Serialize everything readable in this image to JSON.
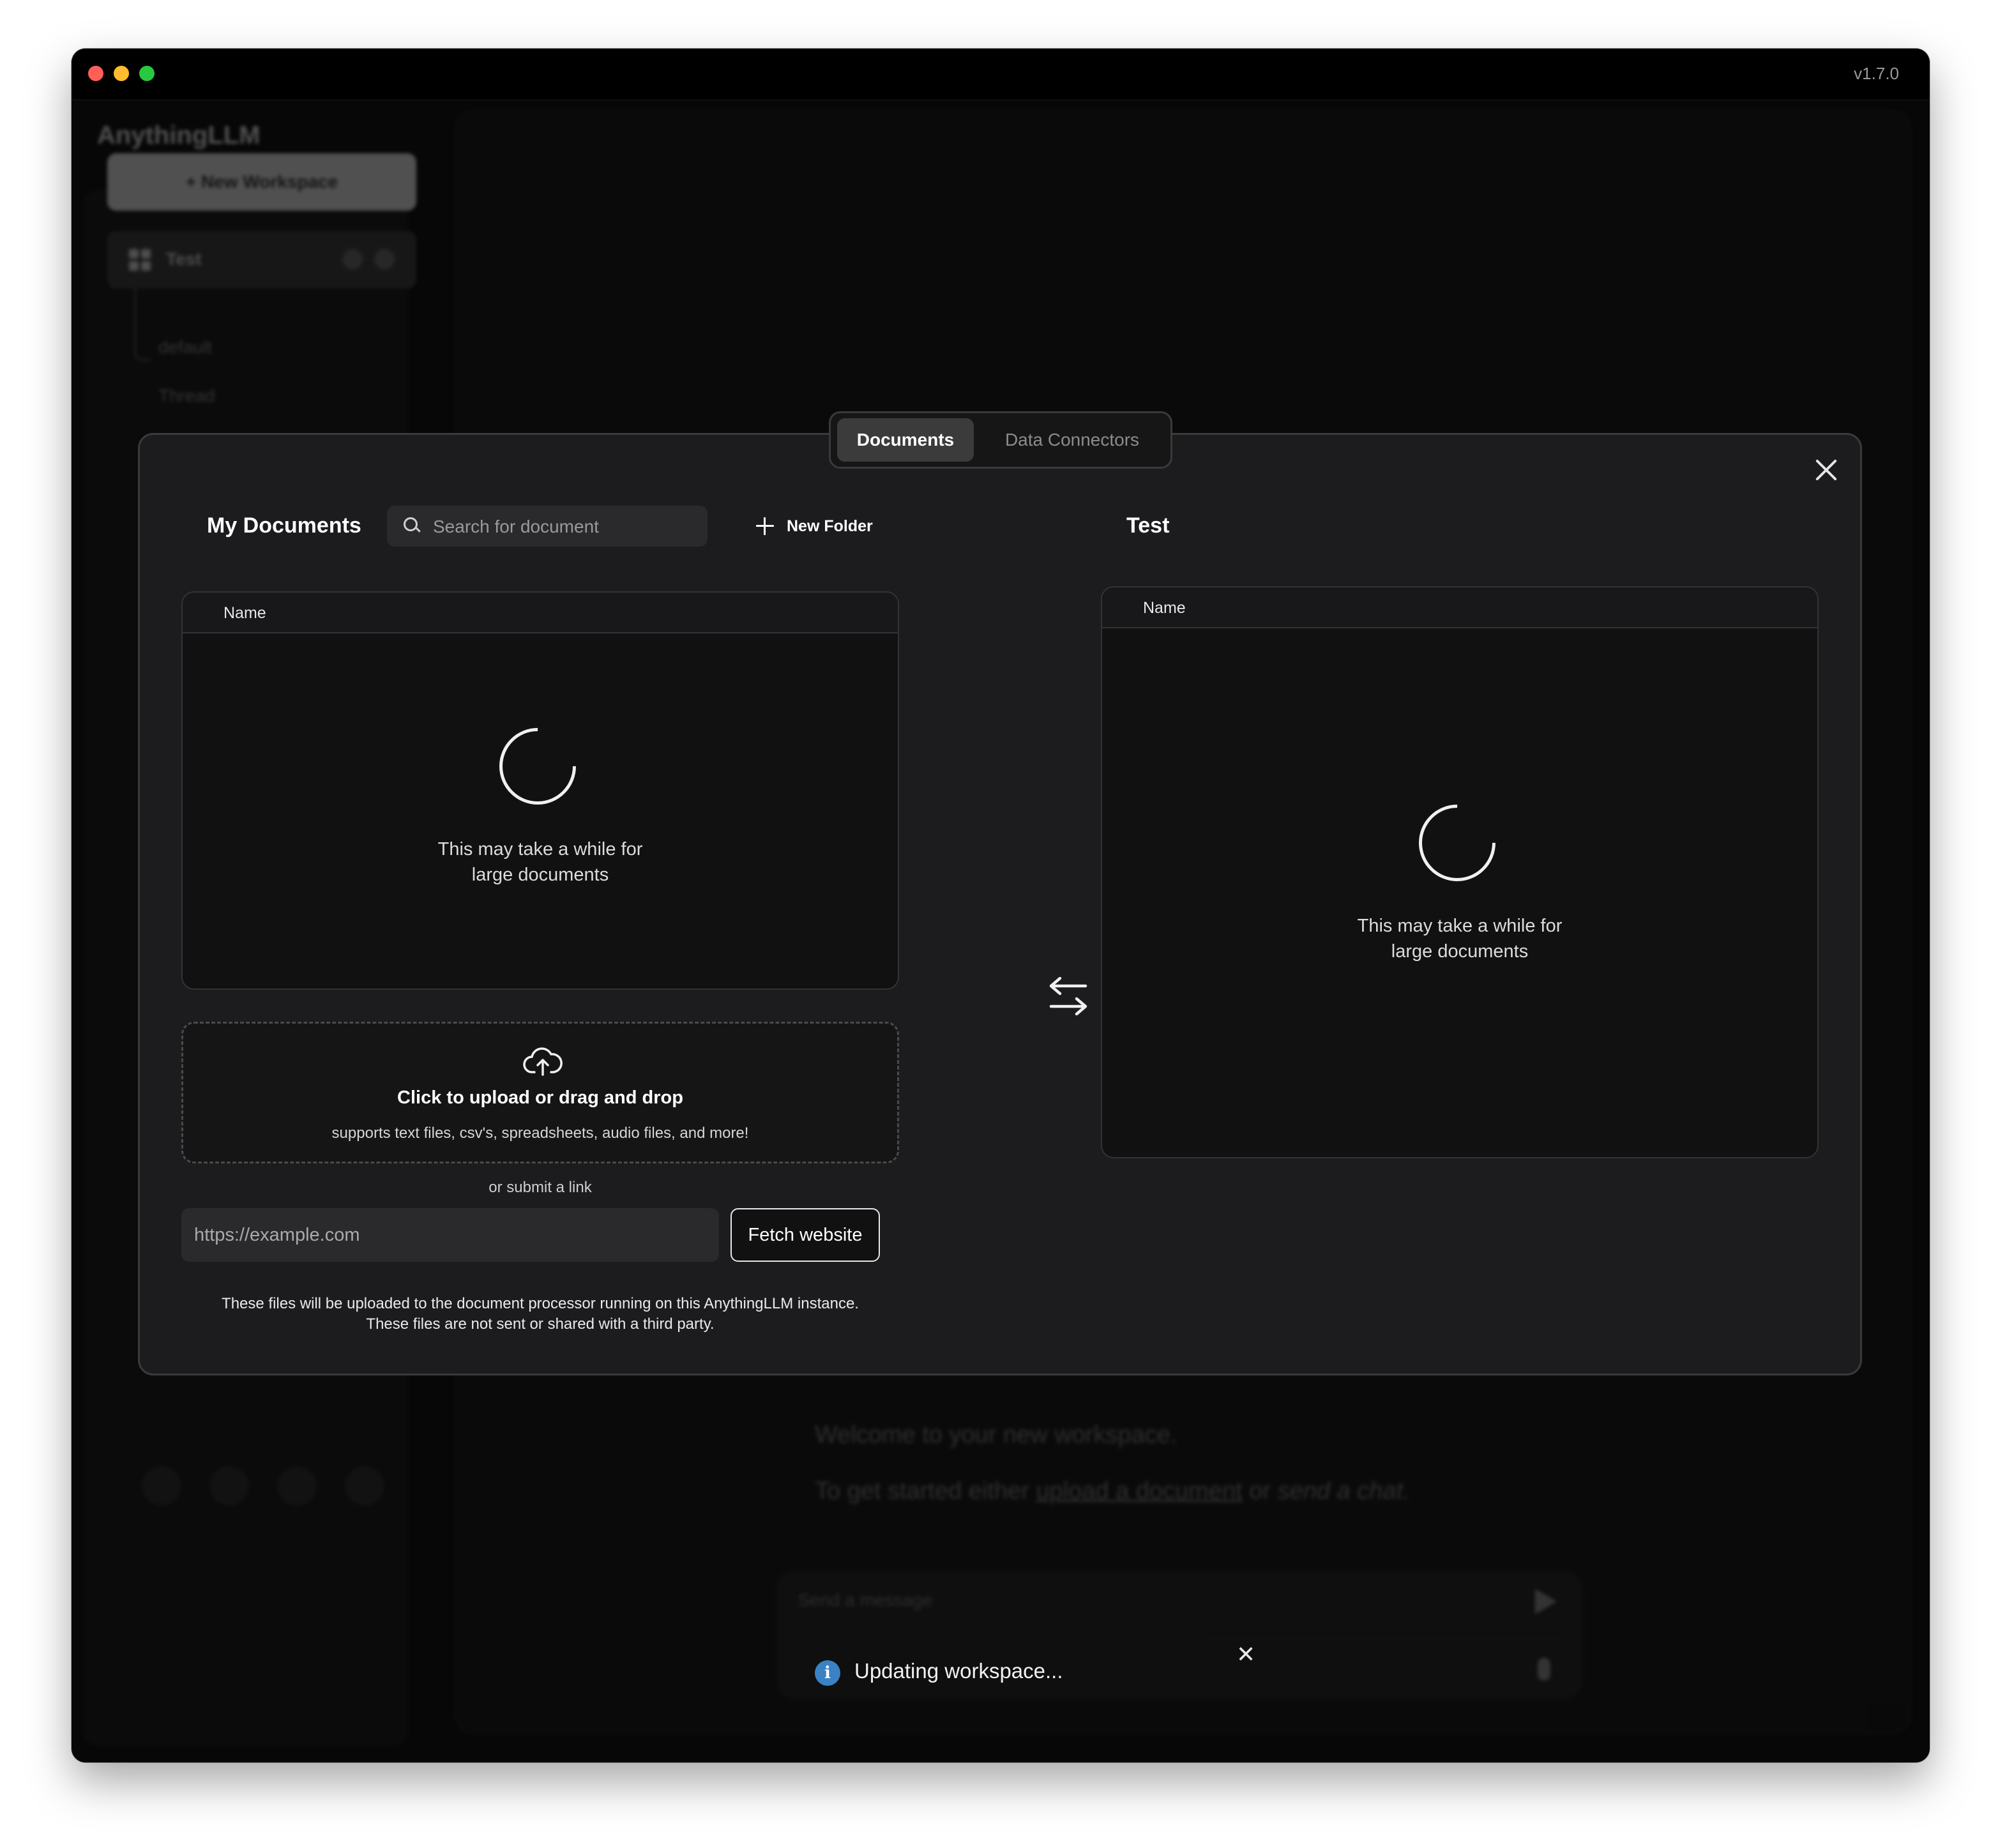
{
  "window": {
    "version": "v1.7.0"
  },
  "background": {
    "brand": "AnythingLLM",
    "new_workspace_label": "+  New Workspace",
    "workspace_name": "Test",
    "threads": [
      "default",
      "Thread"
    ],
    "welcome_line1": "Welcome to your new workspace.",
    "welcome_line2_pre": "To get started either ",
    "welcome_link_upload": "upload a document",
    "welcome_line2_mid": " or ",
    "welcome_link_chat": "send a chat.",
    "chat_placeholder": "Send a message"
  },
  "modal": {
    "tabs": [
      {
        "label": "Documents",
        "active": true
      },
      {
        "label": "Data Connectors",
        "active": false
      }
    ],
    "my_documents_title": "My Documents",
    "search_placeholder": "Search for document",
    "new_folder_label": "New Folder",
    "workspace_title": "Test",
    "left_table": {
      "column": "Name",
      "loading_line1": "This may take a while for",
      "loading_line2": "large documents"
    },
    "right_table": {
      "column": "Name",
      "loading_line1": "This may take a while for",
      "loading_line2": "large documents"
    },
    "upload": {
      "title": "Click to upload or drag and drop",
      "subtitle": "supports text files, csv's, spreadsheets, audio files, and more!"
    },
    "or_submit_link": "or submit a link",
    "url_placeholder": "https://example.com",
    "fetch_button": "Fetch website",
    "notice_line1": "These files will be uploaded to the document processor running on this AnythingLLM instance.",
    "notice_line2": "These files are not sent or shared with a third party."
  },
  "toast": {
    "icon": "i",
    "message": "Updating workspace..."
  },
  "colors": {
    "info_icon": "#3b82c4",
    "background": "#0b0b0b",
    "modal": "#1c1c1e"
  },
  "icons": [
    "search-icon",
    "plus-icon",
    "close-icon",
    "swap-arrows-icon",
    "cloud-upload-icon",
    "info-icon",
    "spinner-icon"
  ]
}
